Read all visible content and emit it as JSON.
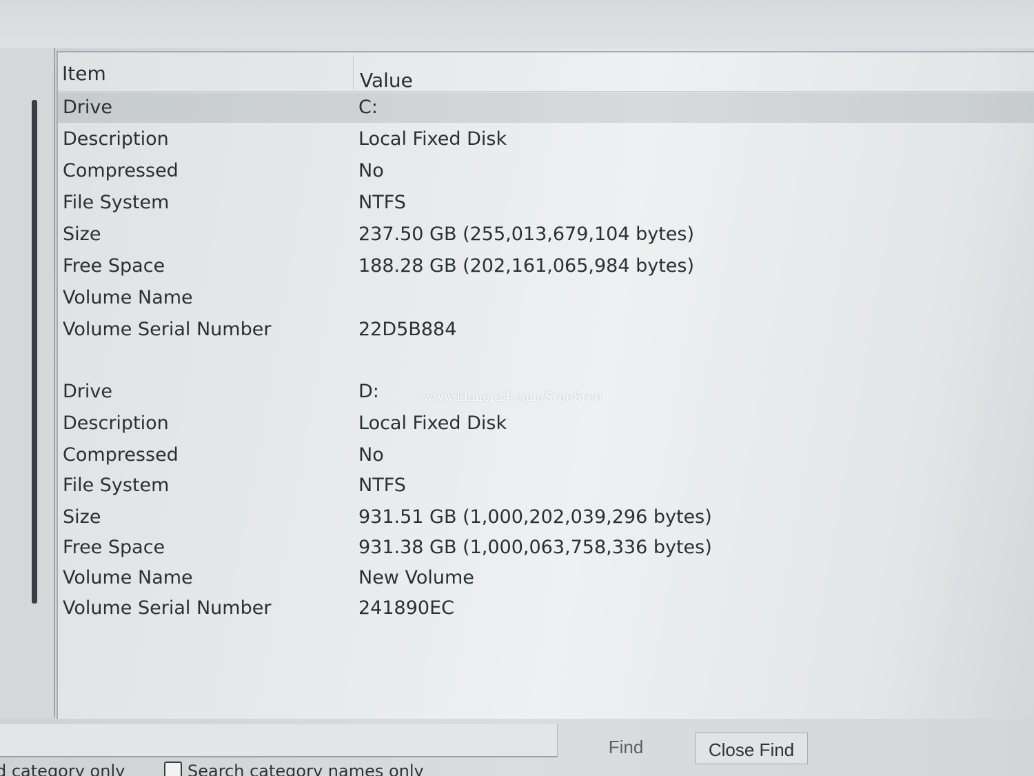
{
  "columns": {
    "item": "Item",
    "value": "Value"
  },
  "rows": [
    {
      "item": "Drive",
      "value": "C:"
    },
    {
      "item": "Description",
      "value": "Local Fixed Disk"
    },
    {
      "item": "Compressed",
      "value": "No"
    },
    {
      "item": "File System",
      "value": "NTFS"
    },
    {
      "item": "Size",
      "value": "237.50 GB (255,013,679,104 bytes)"
    },
    {
      "item": "Free Space",
      "value": "188.28 GB (202,161,065,984 bytes)"
    },
    {
      "item": "Volume Name",
      "value": ""
    },
    {
      "item": "Volume Serial Number",
      "value": "22D5B884"
    },
    {
      "item": "",
      "value": ""
    },
    {
      "item": "Drive",
      "value": "D:"
    },
    {
      "item": "Description",
      "value": "Local Fixed Disk"
    },
    {
      "item": "Compressed",
      "value": "No"
    },
    {
      "item": "File System",
      "value": "NTFS"
    },
    {
      "item": "Size",
      "value": "931.51 GB (1,000,202,039,296 bytes)"
    },
    {
      "item": "Free Space",
      "value": "931.38 GB (1,000,063,758,336 bytes)"
    },
    {
      "item": "Volume Name",
      "value": "New Volume"
    },
    {
      "item": "Volume Serial Number",
      "value": "241890EC"
    }
  ],
  "watermark": "www.khmer24.com/SreuSreu",
  "find_bar": {
    "find_label": "Find",
    "close_find_label": "Close Find",
    "option_selected_category": "d category only",
    "option_search_names": "Search category names only"
  }
}
